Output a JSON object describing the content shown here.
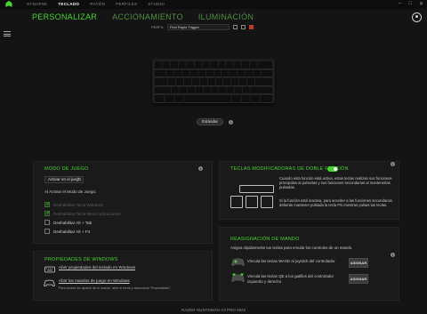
{
  "topnav": {
    "items": [
      "SYNAPSE",
      "TECLADO",
      "RATÓN",
      "PERFILES",
      "STUDIO"
    ],
    "active_index": 1
  },
  "window_controls": [
    "–",
    "□",
    "✕"
  ],
  "subnav": {
    "tabs": [
      "PERSONALIZAR",
      "ACCIONAMIENTO",
      "ILUMINACIÓN"
    ],
    "active_index": 0
  },
  "profile": {
    "label": "PERFIL",
    "value": "First Rapid Trigger"
  },
  "mode_button": "Estándar",
  "game_mode": {
    "title": "MODO DE JUEGO",
    "selected": "Activar en el juego",
    "subtitle": "Al Activar el Modo de Juego:",
    "options": [
      {
        "label": "Deshabilitar Tecla Windows",
        "checked": true,
        "disabled": true
      },
      {
        "label": "Deshabilitar Tecla Menú Aplicaciones",
        "checked": true,
        "disabled": true
      },
      {
        "label": "Deshabilitar Alt + Tab",
        "checked": false,
        "disabled": false
      },
      {
        "label": "Deshabilitar Alt + F4",
        "checked": false,
        "disabled": false
      }
    ]
  },
  "windows_props": {
    "title": "PROPIEDADES DE WINDOWS",
    "link1": "Abrir propiedades del teclado en Windows",
    "link2": "Abrir los mandos de juego en Windows",
    "note": "Para probar los ajustes de tu mando, abre el menú y selecciona \"Propiedades\"."
  },
  "dual_function": {
    "title": "TECLAS MODIFICADORAS DE DOBLE FUNCIÓN",
    "enabled": true,
    "text1": "Cuando esta función está activa, estas teclas realizan sus funciones principales al pulsarlas y sus funciones secundarias al mantenerlas pulsadas.",
    "text2": "Si la función está inactiva, para acceder a las funciones secundarias deberás mantener pulsada la tecla FN mientras pulsas las teclas."
  },
  "controller_remap": {
    "title": "REASIGNACIÓN DE MANDO",
    "intro": "Asigna rápidamente tus teclas para emular los controles de un mando.",
    "row1": "Vincula las teclas WASD al joystick del controlador",
    "row2": "Vincula las teclas QE a los gatillos del controlador izquierdo y derecho",
    "assign_label": "ASIGNAR"
  },
  "status": "RAZER HUNTSMAN V3 PRO MINI",
  "colors": {
    "accent": "#44d62c",
    "background": "#141414",
    "panel": "#1a1a1a"
  }
}
